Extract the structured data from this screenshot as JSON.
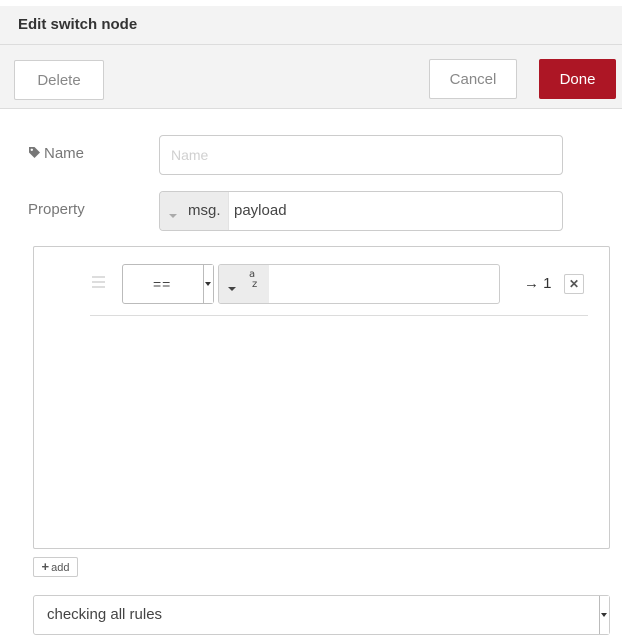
{
  "header": {
    "title": "Edit switch node"
  },
  "toolbar": {
    "delete_label": "Delete",
    "cancel_label": "Cancel",
    "done_label": "Done"
  },
  "form": {
    "name": {
      "label": "Name",
      "placeholder": "Name",
      "value": "",
      "icon": "tag-icon"
    },
    "property": {
      "label": "Property",
      "prefix": "msg.",
      "value": "payload",
      "type_icon": "caret-down-icon"
    }
  },
  "rules": [
    {
      "operator": "==",
      "value_type_icon": "string-az-icon",
      "value_type_glyph_top": "a",
      "value_type_glyph_bottom": "z",
      "value": "",
      "output": "→ 1"
    }
  ],
  "add_label": "add",
  "checking_mode": {
    "selected": "checking all rules"
  },
  "colors": {
    "done_button": "#ad1625",
    "header_bg": "#f3f3f3"
  }
}
